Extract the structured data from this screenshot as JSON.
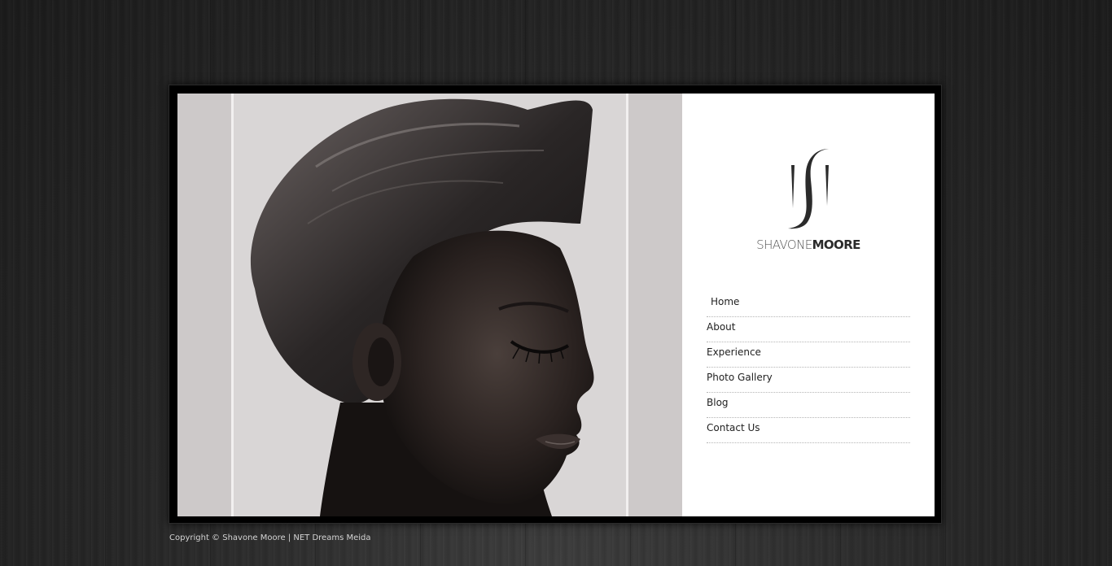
{
  "hero": {
    "alt": "Portrait of Shavone Moore"
  },
  "brand": {
    "monogram": "SM",
    "first_name": "SHAVONE",
    "last_name": "MOORE"
  },
  "nav": {
    "items": [
      {
        "label": "Home",
        "active": true
      },
      {
        "label": "About",
        "active": false
      },
      {
        "label": "Experience",
        "active": false
      },
      {
        "label": "Photo Gallery",
        "active": false
      },
      {
        "label": "Blog",
        "active": false
      },
      {
        "label": "Contact Us",
        "active": false
      }
    ]
  },
  "footer": {
    "copyright": "Copyright © Shavone Moore | NET Dreams Meida"
  },
  "colors": {
    "page_background": "#2a2a2a",
    "frame": "#000000",
    "panel": "#ffffff",
    "photo_backdrop": "#cdc9c9",
    "text": "#222222",
    "footer_text": "#d4d4d4"
  }
}
